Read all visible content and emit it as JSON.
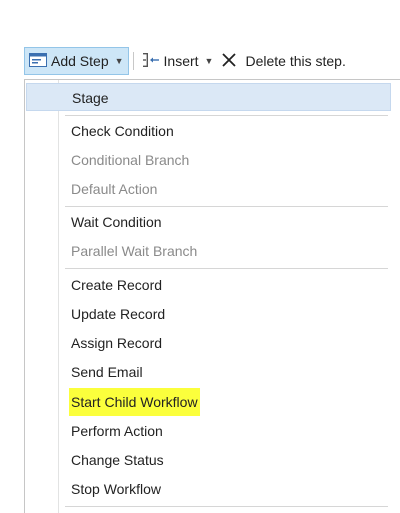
{
  "toolbar": {
    "add_step_label": "Add Step",
    "insert_label": "Insert",
    "delete_label": "Delete this step."
  },
  "menu": {
    "items": [
      {
        "label": "Stage",
        "state": "hover"
      },
      {
        "label": "Check Condition",
        "state": "normal"
      },
      {
        "label": "Conditional Branch",
        "state": "disabled"
      },
      {
        "label": "Default Action",
        "state": "disabled"
      },
      {
        "label": "Wait Condition",
        "state": "normal"
      },
      {
        "label": "Parallel Wait Branch",
        "state": "disabled"
      },
      {
        "label": "Create Record",
        "state": "normal"
      },
      {
        "label": "Update Record",
        "state": "normal"
      },
      {
        "label": "Assign Record",
        "state": "normal"
      },
      {
        "label": "Send Email",
        "state": "normal"
      },
      {
        "label": "Start Child Workflow",
        "state": "highlighted"
      },
      {
        "label": "Perform Action",
        "state": "normal"
      },
      {
        "label": "Change Status",
        "state": "normal"
      },
      {
        "label": "Stop Workflow",
        "state": "normal"
      }
    ]
  },
  "colors": {
    "hover_bg": "#dbe8f6",
    "highlight": "#fbff3c",
    "disabled_text": "#8a8a8a"
  }
}
